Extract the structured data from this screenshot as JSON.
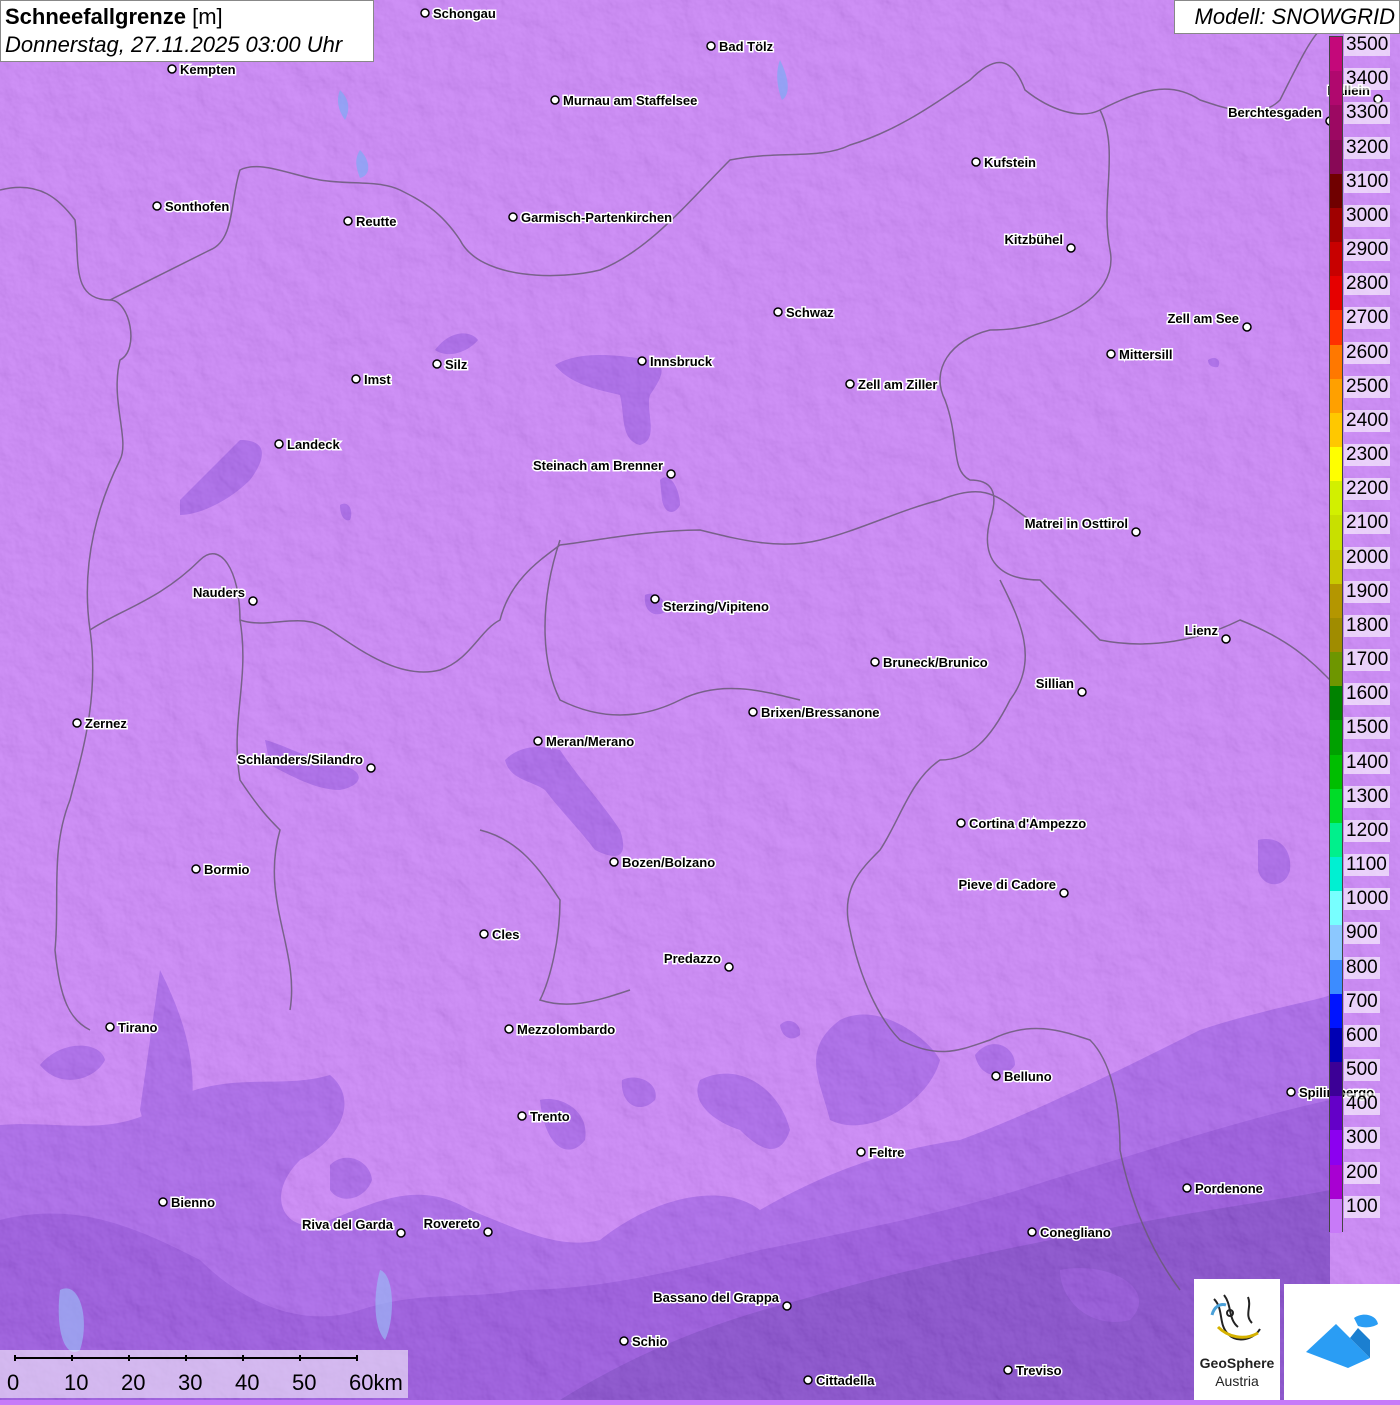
{
  "header": {
    "title": "Schneefallgrenze",
    "unit": "[m]",
    "datetime": "Donnerstag, 27.11.2025 03:00 Uhr",
    "model": "Modell: SNOWGRID"
  },
  "legend": {
    "entries": [
      {
        "label": "3500",
        "color": "#c4087a"
      },
      {
        "label": "3400",
        "color": "#b0086e"
      },
      {
        "label": "3300",
        "color": "#9c0862"
      },
      {
        "label": "3200",
        "color": "#880856"
      },
      {
        "label": "3100",
        "color": "#700000"
      },
      {
        "label": "3000",
        "color": "#a00000"
      },
      {
        "label": "2900",
        "color": "#c80000"
      },
      {
        "label": "2800",
        "color": "#e60000"
      },
      {
        "label": "2700",
        "color": "#ff3000"
      },
      {
        "label": "2600",
        "color": "#ff7800"
      },
      {
        "label": "2500",
        "color": "#ffa000"
      },
      {
        "label": "2400",
        "color": "#ffc800"
      },
      {
        "label": "2300",
        "color": "#ffff00"
      },
      {
        "label": "2200",
        "color": "#d2f000"
      },
      {
        "label": "2100",
        "color": "#c8e000"
      },
      {
        "label": "2000",
        "color": "#c8c800"
      },
      {
        "label": "1900",
        "color": "#b49600"
      },
      {
        "label": "1800",
        "color": "#a08c00"
      },
      {
        "label": "1700",
        "color": "#6e9600"
      },
      {
        "label": "1600",
        "color": "#008200"
      },
      {
        "label": "1500",
        "color": "#00a000"
      },
      {
        "label": "1400",
        "color": "#00be00"
      },
      {
        "label": "1300",
        "color": "#00dc28"
      },
      {
        "label": "1200",
        "color": "#00f08c"
      },
      {
        "label": "1100",
        "color": "#00f0d2"
      },
      {
        "label": "1000",
        "color": "#78ffff"
      },
      {
        "label": "900",
        "color": "#8cc8ff"
      },
      {
        "label": "800",
        "color": "#3c8cff"
      },
      {
        "label": "700",
        "color": "#0014ff"
      },
      {
        "label": "600",
        "color": "#0000b4"
      },
      {
        "label": "500",
        "color": "#3c0096"
      },
      {
        "label": "400",
        "color": "#6400c8"
      },
      {
        "label": "300",
        "color": "#8c00f0"
      },
      {
        "label": "200",
        "color": "#a800d2"
      },
      {
        "label": "100",
        "color": "#c87af8"
      }
    ]
  },
  "scale": {
    "labels": [
      "0",
      "10",
      "20",
      "30",
      "40",
      "50",
      "60km"
    ]
  },
  "logos": {
    "geosphere_name": "GeoSphere",
    "geosphere_country": "Austria",
    "app_icon": "mountain-snow-icon"
  },
  "cities": [
    {
      "name": "Schongau"
    },
    {
      "name": "Bad Tölz"
    },
    {
      "name": "Kempten"
    },
    {
      "name": "Murnau am Staffelsee"
    },
    {
      "name": "Hallein"
    },
    {
      "name": "Berchtesgaden"
    },
    {
      "name": "Kufstein"
    },
    {
      "name": "Sonthofen"
    },
    {
      "name": "Reutte"
    },
    {
      "name": "Garmisch-Partenkirchen"
    },
    {
      "name": "Kitzbühel"
    },
    {
      "name": "Schwaz"
    },
    {
      "name": "Zell am See"
    },
    {
      "name": "Innsbruck"
    },
    {
      "name": "Mittersill"
    },
    {
      "name": "Imst"
    },
    {
      "name": "Silz"
    },
    {
      "name": "Zell am Ziller"
    },
    {
      "name": "Landeck"
    },
    {
      "name": "Steinach am Brenner"
    },
    {
      "name": "Matrei in Osttirol"
    },
    {
      "name": "Nauders"
    },
    {
      "name": "Sterzing/Vipiteno"
    },
    {
      "name": "Lienz"
    },
    {
      "name": "Bruneck/Brunico"
    },
    {
      "name": "Sillian"
    },
    {
      "name": "Brixen/Bressanone"
    },
    {
      "name": "Zernez"
    },
    {
      "name": "Meran/Merano"
    },
    {
      "name": "Schlanders/Silandro"
    },
    {
      "name": "Cortina d'Ampezzo"
    },
    {
      "name": "Bozen/Bolzano"
    },
    {
      "name": "Bormio"
    },
    {
      "name": "Pieve di Cadore"
    },
    {
      "name": "Cles"
    },
    {
      "name": "Predazzo"
    },
    {
      "name": "Tirano"
    },
    {
      "name": "Mezzolombardo"
    },
    {
      "name": "Belluno"
    },
    {
      "name": "Spilimbergo"
    },
    {
      "name": "Trento"
    },
    {
      "name": "Feltre"
    },
    {
      "name": "Pordenone"
    },
    {
      "name": "Bienno"
    },
    {
      "name": "Riva del Garda"
    },
    {
      "name": "Rovereto"
    },
    {
      "name": "Conegliano"
    },
    {
      "name": "Bassano del Grappa"
    },
    {
      "name": "Schio"
    },
    {
      "name": "Treviso"
    },
    {
      "name": "Cittadella"
    }
  ]
}
